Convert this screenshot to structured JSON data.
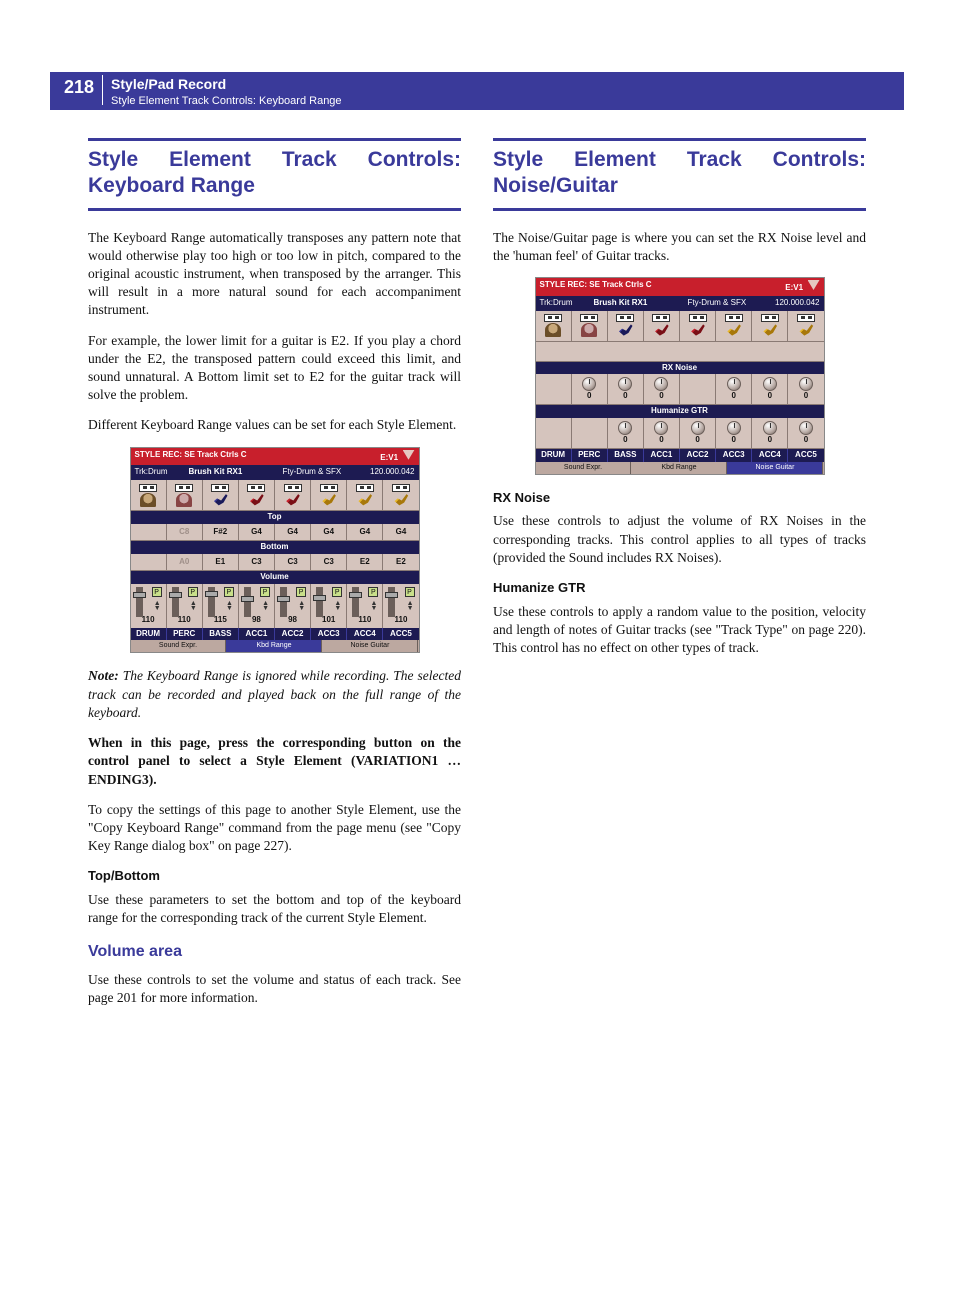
{
  "header": {
    "page_number": "218",
    "title": "Style/Pad Record",
    "subtitle": "Style Element Track Controls: Keyboard Range"
  },
  "left": {
    "heading": "Style Element Track Controls: Keyboard Range",
    "p1": "The Keyboard Range automatically transposes any pattern note that would otherwise play too high or too low in pitch, compared to the original acoustic instrument, when transposed by the arranger. This will result in a more natural sound for each accompaniment instrument.",
    "p2": "For example, the lower limit for a guitar is E2. If you play a chord under the E2, the transposed pattern could exceed this limit, and sound unnatural. A Bottom limit set to E2 for the guitar track will solve the problem.",
    "p3": "Different Keyboard Range values can be set for each Style Element.",
    "note_b": "Note:",
    "note": " The Keyboard Range is ignored while recording. The selected track can be recorded and played back on the full range of the keyboard.",
    "bold": "When in this page, press the corresponding button on the control panel to select a Style Element (VARIATION1 … ENDING3).",
    "p4": "To copy the settings of this page to another Style Element, use the \"Copy Keyboard Range\" command from the page menu (see \"Copy Key Range dialog box\" on page 227).",
    "sub1": "Top/Bottom",
    "p5": "Use these parameters to set the bottom and top of the keyboard range for the corresponding track of the current Style Element.",
    "area": "Volume area",
    "p6": "Use these controls to set the volume and status of each track. See page 201 for more information."
  },
  "right": {
    "heading": "Style Element Track Controls: Noise/Guitar",
    "p1": "The Noise/Guitar page is where you can set the RX Noise level and the 'human feel' of Guitar tracks.",
    "sub1": "RX Noise",
    "p2": "Use these controls to adjust the volume of RX Noises in the corresponding tracks. This control applies to all types of tracks (provided the Sound includes RX Noises).",
    "sub2": "Humanize GTR",
    "p3": "Use these controls to apply a random value to the position, velocity and length of notes of Guitar tracks (see \"Track Type\" on page 220). This control has no effect on other types of track."
  },
  "shot": {
    "title": "STYLE REC: SE Track Ctrls   C",
    "ev": "E:V1",
    "trk": "Trk:Drum",
    "kit": "Brush Kit RX1",
    "bank": "Fty-Drum & SFX",
    "pos": "120.000.042",
    "band_top": "Top",
    "band_bottom": "Bottom",
    "band_volume": "Volume",
    "band_rx": "RX Noise",
    "band_hum": "Humanize GTR",
    "top": [
      "",
      "C8",
      "F#2",
      "G4",
      "G4",
      "G4",
      "G4",
      "G4"
    ],
    "bottom": [
      "",
      "A0",
      "E1",
      "C3",
      "C3",
      "C3",
      "E2",
      "E2"
    ],
    "vol": [
      "110",
      "110",
      "115",
      "98",
      "98",
      "101",
      "110",
      "110"
    ],
    "rx": [
      "",
      "0",
      "0",
      "0",
      "",
      "0",
      "0",
      "0"
    ],
    "hum": [
      "",
      "",
      "0",
      "0",
      "0",
      "0",
      "0",
      "0"
    ],
    "tracks": [
      "DRUM",
      "PERC",
      "BASS",
      "ACC1",
      "ACC2",
      "ACC3",
      "ACC4",
      "ACC5"
    ],
    "tabs": [
      "Sound\nExpr.",
      "Kbd\nRange",
      "Noise\nGuitar"
    ],
    "p": "P"
  }
}
